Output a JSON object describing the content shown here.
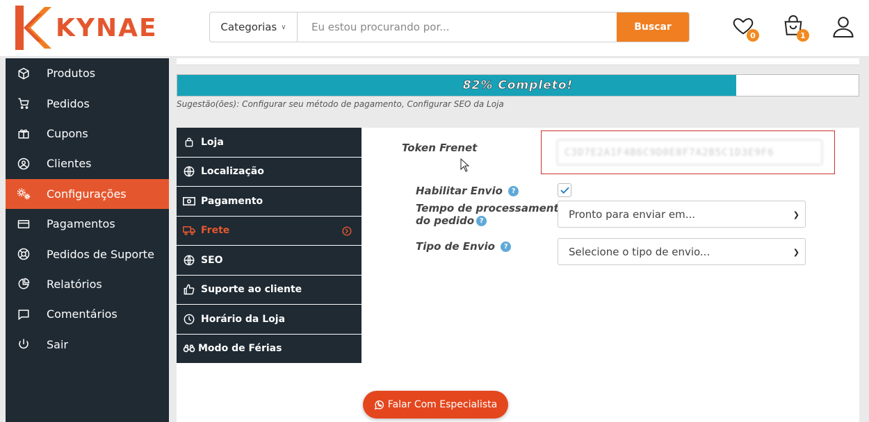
{
  "brand": {
    "name": "KYNAE",
    "accent": "#e4572e",
    "button_orange": "#f07f22"
  },
  "header": {
    "category_label": "Categorias",
    "search_placeholder": "Eu estou procurando por...",
    "search_button": "Buscar",
    "wishlist_count": "0",
    "cart_count": "1"
  },
  "sidebar": {
    "items": [
      {
        "label": "Produtos",
        "icon": "box-icon"
      },
      {
        "label": "Pedidos",
        "icon": "cart-icon"
      },
      {
        "label": "Cupons",
        "icon": "gift-icon"
      },
      {
        "label": "Clientes",
        "icon": "user-circle-icon"
      },
      {
        "label": "Configurações",
        "icon": "gears-icon",
        "active": true
      },
      {
        "label": "Pagamentos",
        "icon": "credit-card-icon"
      },
      {
        "label": "Pedidos de Suporte",
        "icon": "lifebuoy-icon"
      },
      {
        "label": "Relatórios",
        "icon": "pie-chart-icon"
      },
      {
        "label": "Comentários",
        "icon": "comment-icon"
      },
      {
        "label": "Sair",
        "icon": "power-icon"
      }
    ]
  },
  "progress": {
    "value": 82,
    "text": "82% Completo!",
    "fill_color": "#17a2b8"
  },
  "suggestion": "Sugestão(ões): Configurar seu método de pagamento, Configurar SEO da Loja",
  "settings_menu": {
    "items": [
      {
        "label": "Loja",
        "icon": "bag-icon"
      },
      {
        "label": "Localização",
        "icon": "globe-icon"
      },
      {
        "label": "Pagamento",
        "icon": "money-icon"
      },
      {
        "label": "Frete",
        "icon": "truck-icon",
        "active": true
      },
      {
        "label": "SEO",
        "icon": "globe-icon"
      },
      {
        "label": "Suporte ao cliente",
        "icon": "thumbs-up-icon"
      },
      {
        "label": "Horário da Loja",
        "icon": "clock-icon"
      },
      {
        "label": "Modo de Férias",
        "icon": "binoculars-icon"
      }
    ]
  },
  "form": {
    "token_label": "Token Frenet",
    "token_value": "C3D7E2A1F4B6C9D0E8F7A2B5C1D3E9F6",
    "enable_label": "Habilitar Envio",
    "enable_checked": true,
    "processing_label_line1": "Tempo de processamento",
    "processing_label_line2": "do pedido",
    "processing_value": "Pronto para enviar em...",
    "shipping_type_label": "Tipo de Envio",
    "shipping_type_value": "Selecione o tipo de envio..."
  },
  "cta": {
    "label": "Falar Com Especialista"
  }
}
